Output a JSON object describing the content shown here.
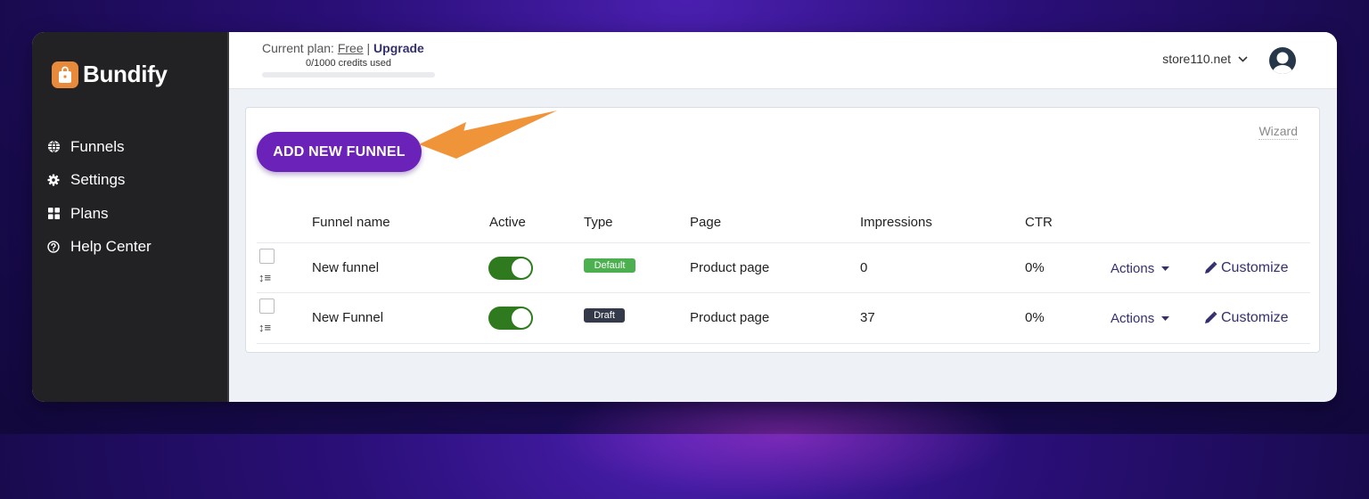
{
  "app": {
    "name": "Bundify"
  },
  "sidebar": {
    "items": [
      {
        "label": "Funnels",
        "icon": "globe-icon"
      },
      {
        "label": "Settings",
        "icon": "gear-icon"
      },
      {
        "label": "Plans",
        "icon": "grid-icon"
      },
      {
        "label": "Help Center",
        "icon": "question-circle-icon"
      }
    ]
  },
  "header": {
    "plan_prefix": "Current plan: ",
    "plan_name": "Free",
    "plan_sep": " | ",
    "upgrade_label": "Upgrade",
    "credits_text": "0/1000 credits used",
    "credits_used": 0,
    "credits_total": 1000,
    "store_name": "store110.net"
  },
  "main": {
    "add_button_label": "ADD NEW FUNNEL",
    "wizard_label": "Wizard",
    "columns": [
      "Funnel name",
      "Active",
      "Type",
      "Page",
      "Impressions",
      "CTR"
    ],
    "rows": [
      {
        "name": "New funnel",
        "active": true,
        "type": "Default",
        "type_color": "#4caf50",
        "page": "Product page",
        "impressions": "0",
        "ctr": "0%",
        "actions_label": "Actions",
        "customize_label": "Customize"
      },
      {
        "name": "New Funnel",
        "active": true,
        "type": "Draft",
        "type_color": "#343a4a",
        "page": "Product page",
        "impressions": "37",
        "ctr": "0%",
        "actions_label": "Actions",
        "customize_label": "Customize"
      }
    ]
  },
  "colors": {
    "accent": "#6a22b8",
    "sidebar_bg": "#222224",
    "toggle_on": "#2f7a1f",
    "link": "#34306e",
    "annotation_arrow": "#f0943a"
  }
}
